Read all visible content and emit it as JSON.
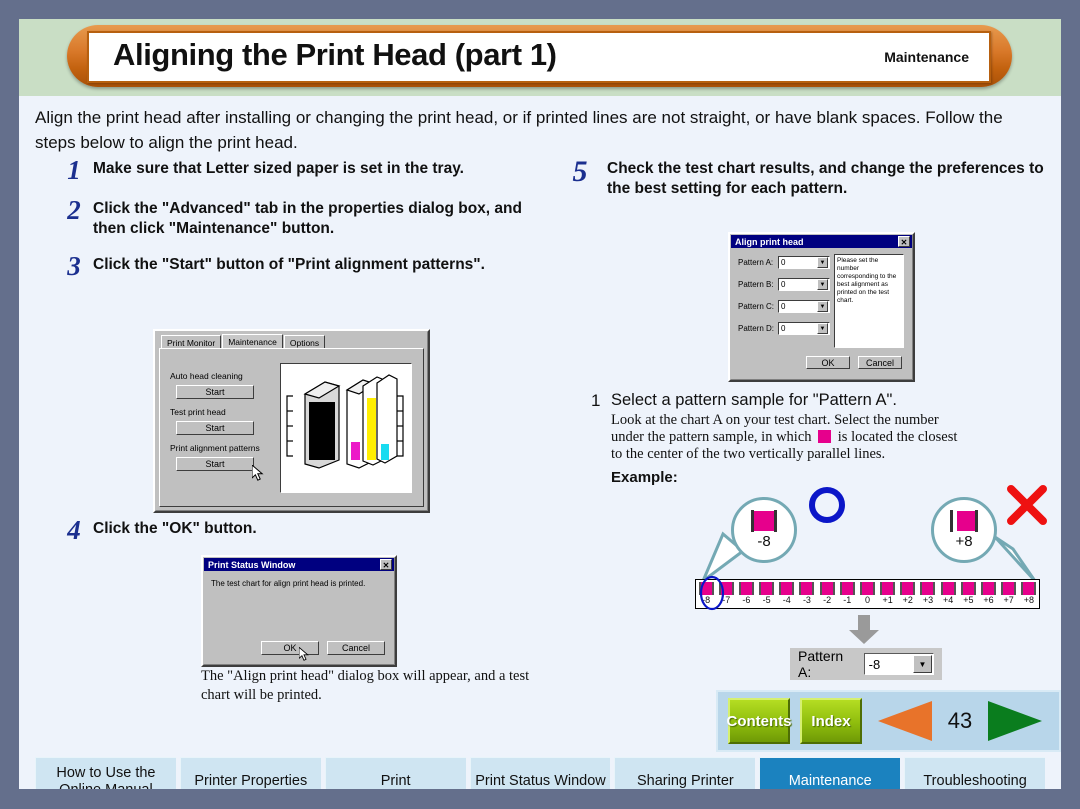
{
  "header": {
    "title": "Aligning the Print Head (part 1)",
    "section": "Maintenance"
  },
  "intro": "Align the print head after installing or changing the print head, or if printed lines are not straight, or have blank spaces. Follow the steps below to align the print head.",
  "steps_left": [
    {
      "num": "1",
      "text": "Make sure that Letter sized paper is set in the tray."
    },
    {
      "num": "2",
      "text": "Click the \"Advanced\" tab in the properties dialog box, and then click \"Maintenance\" button."
    },
    {
      "num": "3",
      "text": "Click the \"Start\" button of \"Print alignment patterns\"."
    },
    {
      "num": "4",
      "text": "Click the \"OK\" button."
    }
  ],
  "step5": {
    "num": "5",
    "text": "Check the test chart results, and change the preferences to the best setting for each pattern."
  },
  "props_dialog": {
    "tabs": [
      "Print Monitor",
      "Maintenance",
      "Options"
    ],
    "active_tab": "Maintenance",
    "groups": [
      {
        "label": "Auto head cleaning",
        "button": "Start"
      },
      {
        "label": "Test print head",
        "button": "Start"
      },
      {
        "label": "Print alignment patterns",
        "button": "Start"
      }
    ]
  },
  "status_dialog": {
    "title": "Print Status Window",
    "message": "The test chart for align print head is printed.",
    "ok": "OK",
    "cancel": "Cancel",
    "close": "✕"
  },
  "status_caption": "The \"Align print head\" dialog box will appear, and a test chart will be printed.",
  "align_dialog": {
    "title": "Align print head",
    "close": "✕",
    "patterns": [
      {
        "label": "Pattern A:",
        "value": "0"
      },
      {
        "label": "Pattern B:",
        "value": "0"
      },
      {
        "label": "Pattern C:",
        "value": "0"
      },
      {
        "label": "Pattern D:",
        "value": "0"
      }
    ],
    "note": "Please set the number corresponding to the best alignment as printed on the test chart.",
    "ok": "OK",
    "cancel": "Cancel"
  },
  "substep1": {
    "num": "1",
    "heading": "Select a pattern sample for \"Pattern A\".",
    "detail_a": "Look at the chart A on your test chart. Select the number",
    "detail_b": "under the pattern sample, in which",
    "detail_c": "is located the closest",
    "detail_d": "to the center of the two vertically parallel lines.",
    "example_label": "Example:"
  },
  "example": {
    "good_value": "-8",
    "bad_value": "+8",
    "good_mark": "circle-ok",
    "bad_mark": "cross-ng",
    "scale_labels": [
      "-8",
      "-7",
      "-6",
      "-5",
      "-4",
      "-3",
      "-2",
      "-1",
      "0",
      "+1",
      "+2",
      "+3",
      "+4",
      "+5",
      "+6",
      "+7",
      "+8"
    ],
    "selected": "-8",
    "pattern_select": {
      "label": "Pattern A:",
      "value": "-8"
    }
  },
  "nav": {
    "contents": "Contents",
    "index": "Index",
    "page": "43",
    "prev": "prev-arrow",
    "next": "next-arrow"
  },
  "tabs": [
    {
      "label": "How to Use the Online Manual",
      "active": false
    },
    {
      "label": "Printer Properties",
      "active": false
    },
    {
      "label": "Print",
      "active": false
    },
    {
      "label": "Print Status Window",
      "active": false
    },
    {
      "label": "Sharing Printer",
      "active": false
    },
    {
      "label": "Maintenance",
      "active": true
    },
    {
      "label": "Troubleshooting",
      "active": false
    }
  ],
  "colors": {
    "accent": "#d9792a",
    "band": "#c9dec5",
    "page": "#eef3fb",
    "frame": "#646f8c",
    "active_tab": "#1b82bf",
    "magenta": "#e6008c"
  }
}
